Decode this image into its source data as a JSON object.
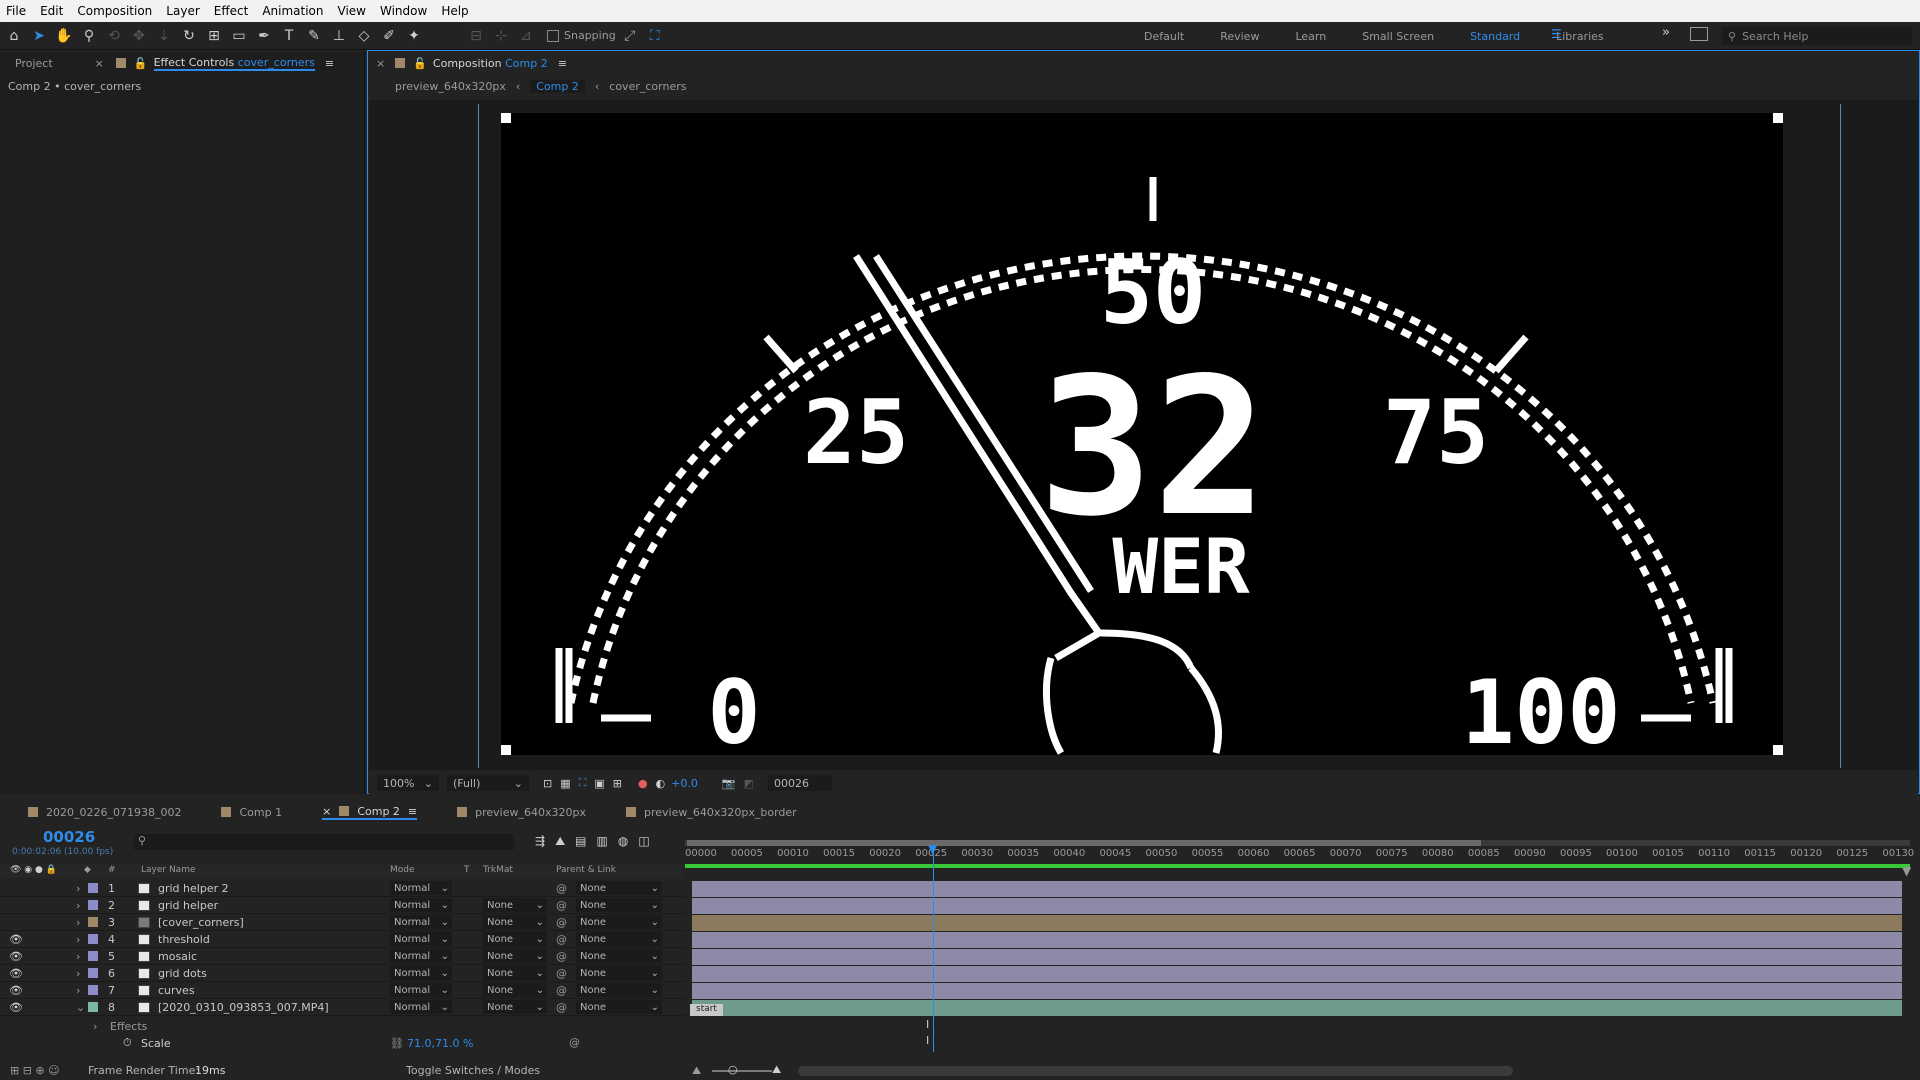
{
  "menu": [
    "File",
    "Edit",
    "Composition",
    "Layer",
    "Effect",
    "Animation",
    "View",
    "Window",
    "Help"
  ],
  "toolbar": {
    "snapping_label": "Snapping"
  },
  "workspaces": {
    "items": [
      "Default",
      "Review",
      "Learn",
      "Small Screen",
      "Standard",
      "Libraries"
    ],
    "active": "Standard"
  },
  "search": {
    "placeholder": "Search Help"
  },
  "left_panel": {
    "tab_project": "Project",
    "tab_effect_controls": "Effect Controls",
    "effect_layer": "cover_corners",
    "breadcrumb": "Comp 2 • cover_corners"
  },
  "comp_panel": {
    "tab_label": "Composition",
    "tab_comp": "Comp 2",
    "breadcrumbs": [
      "preview_640x320px",
      "Comp 2",
      "cover_corners"
    ],
    "zoom": "100%",
    "resolution": "(Full)",
    "exposure": "+0.0",
    "frame": "00026"
  },
  "gauge": {
    "top_value": "50",
    "left_value": "25",
    "right_value": "75",
    "center_value": "32",
    "center_text": "WER",
    "min_value": "0",
    "max_value": "100"
  },
  "timeline": {
    "tabs": [
      {
        "label": "2020_0226_071938_002",
        "color": "#a08868"
      },
      {
        "label": "Comp 1",
        "color": "#a08868"
      },
      {
        "label": "Comp 2",
        "color": "#a08868"
      },
      {
        "label": "preview_640x320px",
        "color": "#a08868"
      },
      {
        "label": "preview_640x320px_border",
        "color": "#a08868"
      }
    ],
    "current_frame": "00026",
    "timecode": "0:00:02:06 (10.00 fps)",
    "columns": {
      "layer_name": "Layer Name",
      "mode": "Mode",
      "t": "T",
      "trkmat": "TrkMat",
      "parent": "Parent & Link"
    },
    "ruler_ticks": [
      "00000",
      "00005",
      "00010",
      "00015",
      "00020",
      "00025",
      "00030",
      "00035",
      "00040",
      "00045",
      "00050",
      "00055",
      "00060",
      "00065",
      "00070",
      "00075",
      "00080",
      "00085",
      "00090",
      "00095",
      "00100",
      "00105",
      "00110",
      "00115",
      "00120",
      "00125",
      "00130"
    ],
    "layers": [
      {
        "num": "1",
        "name": "grid helper 2",
        "mode": "Normal",
        "trkmat": "",
        "parent": "None",
        "label_color": "#8c8cc8",
        "visible": false
      },
      {
        "num": "2",
        "name": "grid helper",
        "mode": "Normal",
        "trkmat": "None",
        "parent": "None",
        "label_color": "#8c8cc8",
        "visible": false
      },
      {
        "num": "3",
        "name": "[cover_corners]",
        "mode": "Normal",
        "trkmat": "None",
        "parent": "None",
        "label_color": "#a08868",
        "visible": false
      },
      {
        "num": "4",
        "name": "threshold",
        "mode": "Normal",
        "trkmat": "None",
        "parent": "None",
        "label_color": "#8c8cc8",
        "visible": true
      },
      {
        "num": "5",
        "name": "mosaic",
        "mode": "Normal",
        "trkmat": "None",
        "parent": "None",
        "label_color": "#8c8cc8",
        "visible": true
      },
      {
        "num": "6",
        "name": "grid dots",
        "mode": "Normal",
        "trkmat": "None",
        "parent": "None",
        "label_color": "#8c8cc8",
        "visible": true
      },
      {
        "num": "7",
        "name": "curves",
        "mode": "Normal",
        "trkmat": "None",
        "parent": "None",
        "label_color": "#8c8cc8",
        "visible": true
      },
      {
        "num": "8",
        "name": "[2020_0310_093853_007.MP4]",
        "mode": "Normal",
        "trkmat": "None",
        "parent": "None",
        "label_color": "#7ab8a0",
        "visible": true
      }
    ],
    "effects_label": "Effects",
    "scale_label": "Scale",
    "scale_value": "71.0,71.0 %",
    "marker_label": "start"
  },
  "status": {
    "render_label": "Frame Render Time:",
    "render_value": "19ms",
    "toggle_label": "Toggle Switches / Modes"
  },
  "colors": {
    "accent": "#2d8ceb",
    "bar_purple": "#8d8aa8",
    "bar_tan": "#8c7a5e",
    "bar_teal": "#6f9a8e"
  }
}
